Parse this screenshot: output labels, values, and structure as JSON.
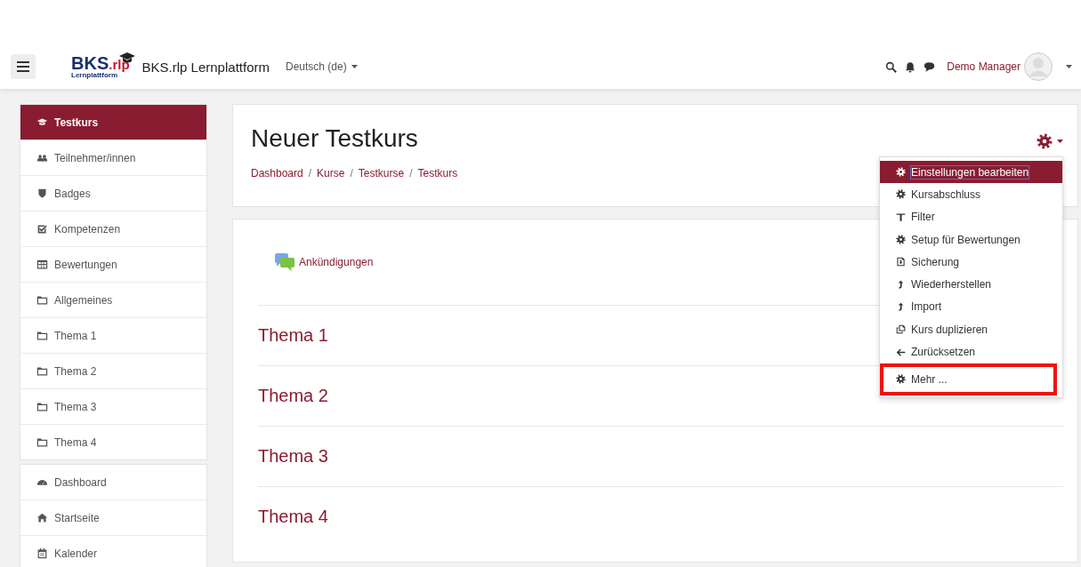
{
  "navbar": {
    "logo": {
      "main": "BKS",
      "suffix": ".rlp",
      "sub": "Lernplattform"
    },
    "site_name": "BKS.rlp Lernplattform",
    "language": "Deutsch (de)",
    "user": "Demo Manager"
  },
  "sidebar": {
    "groups": [
      [
        {
          "label": "Testkurs",
          "kind": "course",
          "selected": true
        },
        {
          "label": "Teilnehmer/innen",
          "kind": "users",
          "selected": false
        },
        {
          "label": "Badges",
          "kind": "shield",
          "selected": false
        },
        {
          "label": "Kompetenzen",
          "kind": "check",
          "selected": false
        },
        {
          "label": "Bewertungen",
          "kind": "table",
          "selected": false
        },
        {
          "label": "Allgemeines",
          "kind": "folder",
          "selected": false
        },
        {
          "label": "Thema 1",
          "kind": "folder",
          "selected": false
        },
        {
          "label": "Thema 2",
          "kind": "folder",
          "selected": false
        },
        {
          "label": "Thema 3",
          "kind": "folder",
          "selected": false
        },
        {
          "label": "Thema 4",
          "kind": "folder",
          "selected": false
        }
      ],
      [
        {
          "label": "Dashboard",
          "kind": "dashboard",
          "selected": false
        },
        {
          "label": "Startseite",
          "kind": "home",
          "selected": false
        },
        {
          "label": "Kalender",
          "kind": "calendar",
          "selected": false
        }
      ]
    ]
  },
  "header": {
    "title": "Neuer Testkurs",
    "breadcrumb": [
      "Dashboard",
      "Kurse",
      "Testkurse",
      "Testkurs"
    ],
    "separator": "/"
  },
  "settings_menu": {
    "items": [
      {
        "label": "Einstellungen bearbeiten",
        "kind": "gear",
        "selected": true,
        "highlighted": false
      },
      {
        "label": "Kursabschluss",
        "kind": "gear",
        "selected": false,
        "highlighted": false
      },
      {
        "label": "Filter",
        "kind": "filter",
        "selected": false,
        "highlighted": false
      },
      {
        "label": "Setup für Bewertungen",
        "kind": "gear",
        "selected": false,
        "highlighted": false
      },
      {
        "label": "Sicherung",
        "kind": "file",
        "selected": false,
        "highlighted": false
      },
      {
        "label": "Wiederherstellen",
        "kind": "upload",
        "selected": false,
        "highlighted": false
      },
      {
        "label": "Import",
        "kind": "upload",
        "selected": false,
        "highlighted": false
      },
      {
        "label": "Kurs duplizieren",
        "kind": "copy",
        "selected": false,
        "highlighted": false
      },
      {
        "label": "Zurücksetzen",
        "kind": "back",
        "selected": false,
        "highlighted": false
      },
      {
        "label": "Mehr ...",
        "kind": "gear",
        "selected": false,
        "highlighted": true
      }
    ]
  },
  "content": {
    "forum": "Ankündigungen",
    "sections": [
      "Thema 1",
      "Thema 2",
      "Thema 3",
      "Thema 4"
    ]
  }
}
